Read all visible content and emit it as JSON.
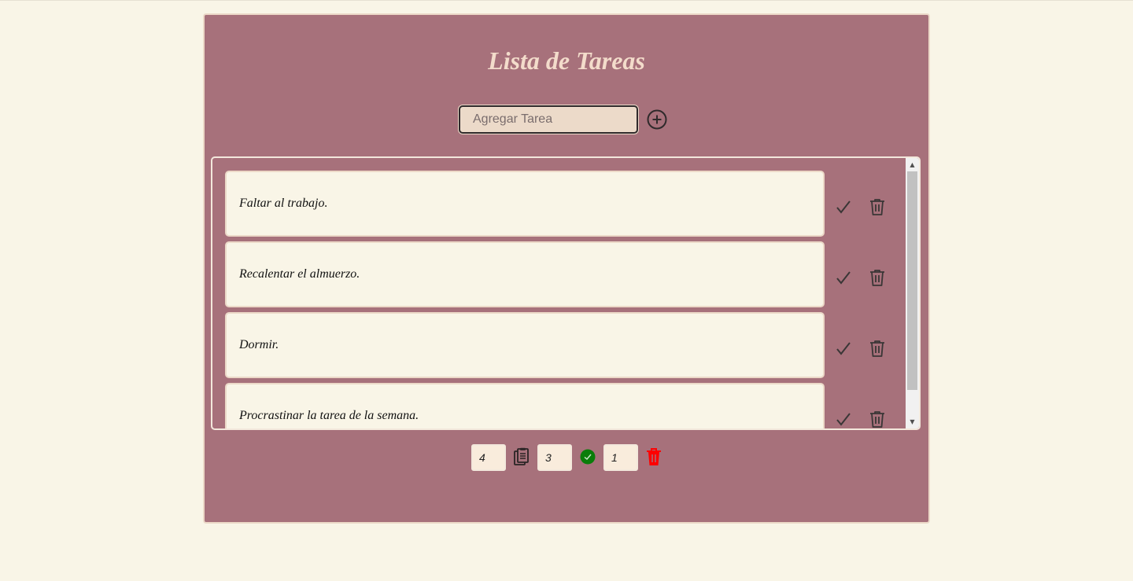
{
  "app": {
    "title": "Lista de Tareas"
  },
  "input": {
    "placeholder": "Agregar Tarea",
    "value": ""
  },
  "add_button": {
    "icon": "plus-circle-icon"
  },
  "tasks": [
    {
      "text": "Faltar al trabajo."
    },
    {
      "text": "Recalentar el almuerzo."
    },
    {
      "text": "Dormir."
    },
    {
      "text": "Procrastinar la tarea de la semana."
    }
  ],
  "counters": {
    "total": "4",
    "completed": "3",
    "deleted": "1"
  },
  "icons": {
    "total": "clipboard-icon",
    "completed": "check-circle-icon",
    "deleted": "trash-icon"
  },
  "colors": {
    "background": "#f9f5e7",
    "card": "#a7717b",
    "title": "#f3dccb",
    "completed_icon": "#0a7d0a",
    "deleted_icon": "#ff0000"
  }
}
